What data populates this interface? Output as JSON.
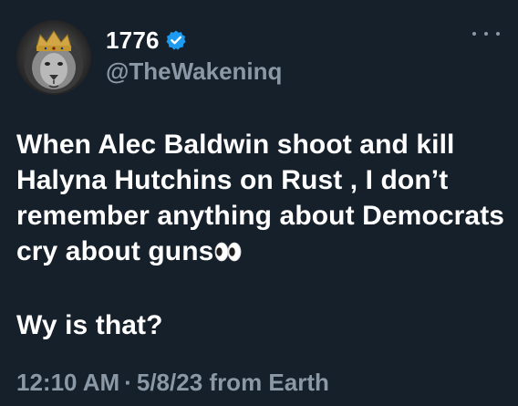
{
  "author": {
    "display_name": "1776",
    "handle": "@TheWakeninq",
    "verified": true,
    "avatar_icon": "lion-with-crown-avatar"
  },
  "menu": {
    "icon": "more-options-icon"
  },
  "tweet": {
    "lines": [
      "When Alec Baldwin shoot and kill",
      "Halyna Hutchins on Rust , I don’t",
      "remember anything about Democrats",
      "cry about guns"
    ],
    "emoji": "eyes-emoji",
    "second_paragraph": "Wy is that?"
  },
  "meta": {
    "time": "12:10 AM",
    "separator": "·",
    "date": "5/8/23",
    "source_prefix": "from",
    "source": "Earth"
  },
  "colors": {
    "background": "#15202b",
    "text": "#ffffff",
    "secondary_text": "#8b98a5",
    "verified_badge": "#1d9bf0"
  }
}
